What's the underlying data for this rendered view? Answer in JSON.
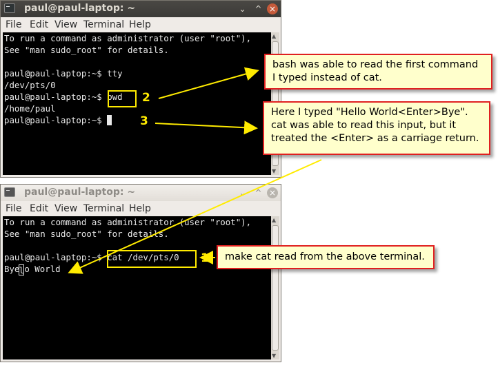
{
  "terminal_top": {
    "title": "paul@paul-laptop: ~",
    "window_buttons": [
      "⌄",
      "^",
      "×"
    ],
    "menu": [
      "File",
      "Edit",
      "View",
      "Terminal",
      "Help"
    ],
    "lines": [
      "To run a command as administrator (user \"root\"),",
      "See \"man sudo_root\" for details.",
      "",
      "paul@paul-laptop:~$ tty",
      "/dev/pts/0",
      "paul@paul-laptop:~$ pwd",
      "/home/paul",
      "paul@paul-laptop:~$ "
    ]
  },
  "terminal_bottom": {
    "title": "paul@paul-laptop: ~",
    "window_buttons": [
      "⌄",
      "^",
      "×"
    ],
    "menu": [
      "File",
      "Edit",
      "View",
      "Terminal",
      "Help"
    ],
    "lines": [
      "To run a command as administrator (user \"root\"),",
      "See \"man sudo_root\" for details.",
      "",
      "paul@paul-laptop:~$ cat /dev/pts/0",
      "Bye",
      "o World"
    ],
    "cursor_char": "l"
  },
  "annotations": {
    "num1": "1",
    "num2": "2",
    "num3": "3",
    "callout_first_command": "bash was able to read the first command I typed instead of cat.",
    "callout_hello_world": "Here I typed \"Hello World<Enter>Bye\". cat was able to read this input, but it treated the <Enter> as a carriage return.",
    "callout_make_cat": "make cat read from the above terminal."
  },
  "colors": {
    "highlight": "#ffeb00",
    "callout_border": "#e02020",
    "callout_bg": "#ffffcc",
    "terminal_bg": "#000000"
  }
}
